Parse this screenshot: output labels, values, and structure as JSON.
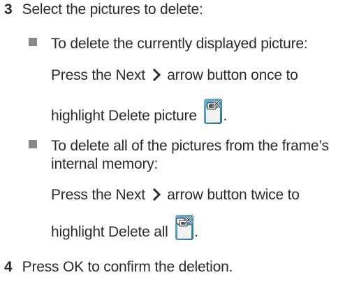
{
  "steps": [
    {
      "number": "3",
      "text": "Select the pictures to delete:"
    },
    {
      "number": "4",
      "text": "Press OK to confirm the deletion."
    }
  ],
  "bullets": [
    {
      "lead": "To delete the currently displayed picture:",
      "line1_before": "Press the Next",
      "line1_after": "arrow button once to",
      "line2_before": "highlight Delete picture",
      "line2_after": ".",
      "icon": "delete-picture-icon"
    },
    {
      "lead_line1": "To delete all of the pictures from the frame’s",
      "lead_line2": "internal memory:",
      "line1_before": "Press the Next",
      "line1_after": "arrow button twice to",
      "line2_before": "highlight Delete all",
      "line2_after": ".",
      "icon": "delete-all-icon"
    }
  ],
  "icons": {
    "next_arrow": "chevron-right-icon"
  },
  "colors": {
    "text": "#2b2b2b",
    "bullet": "#8a8a8a"
  }
}
